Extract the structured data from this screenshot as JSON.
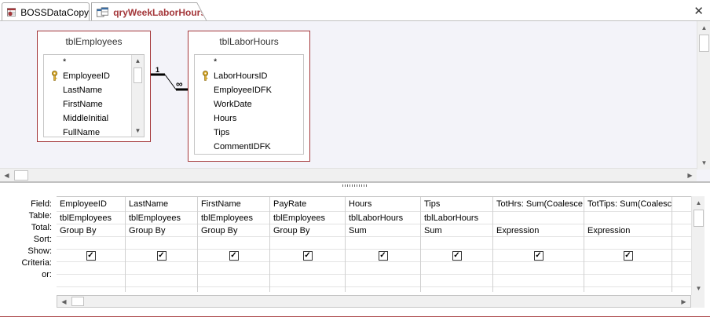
{
  "tabs": [
    {
      "label": "BOSSDataCopy",
      "icon": "table-icon"
    },
    {
      "label": "qryWeekLaborHours",
      "icon": "query-icon",
      "active": true
    }
  ],
  "close_glyph": "✕",
  "tables": {
    "employees": {
      "title": "tblEmployees",
      "fields": [
        "*",
        "EmployeeID",
        "LastName",
        "FirstName",
        "MiddleInitial",
        "FullName"
      ],
      "key_field": "EmployeeID"
    },
    "labor": {
      "title": "tblLaborHours",
      "fields": [
        "*",
        "LaborHoursID",
        "EmployeeIDFK",
        "WorkDate",
        "Hours",
        "Tips",
        "CommentIDFK"
      ],
      "key_field": "LaborHoursID"
    }
  },
  "relationship": {
    "one_side": "1",
    "many_side": "∞"
  },
  "row_labels": [
    "Field:",
    "Table:",
    "Total:",
    "Sort:",
    "Show:",
    "Criteria:",
    "or:"
  ],
  "columns": [
    {
      "field": "EmployeeID",
      "table": "tblEmployees",
      "total": "Group By",
      "show": true
    },
    {
      "field": "LastName",
      "table": "tblEmployees",
      "total": "Group By",
      "show": true
    },
    {
      "field": "FirstName",
      "table": "tblEmployees",
      "total": "Group By",
      "show": true
    },
    {
      "field": "PayRate",
      "table": "tblEmployees",
      "total": "Group By",
      "show": true
    },
    {
      "field": "Hours",
      "table": "tblLaborHours",
      "total": "Sum",
      "show": true
    },
    {
      "field": "Tips",
      "table": "tblLaborHours",
      "total": "Sum",
      "show": true
    },
    {
      "field": "TotHrs: Sum(Coalesce",
      "table": "",
      "total": "Expression",
      "show": true
    },
    {
      "field": "TotTips: Sum(Coalesce",
      "table": "",
      "total": "Expression",
      "show": true
    },
    {
      "field": "",
      "table": "",
      "total": "",
      "show": false
    }
  ],
  "colors": {
    "accent": "#a4373a",
    "surface": "#f3f3f9"
  }
}
